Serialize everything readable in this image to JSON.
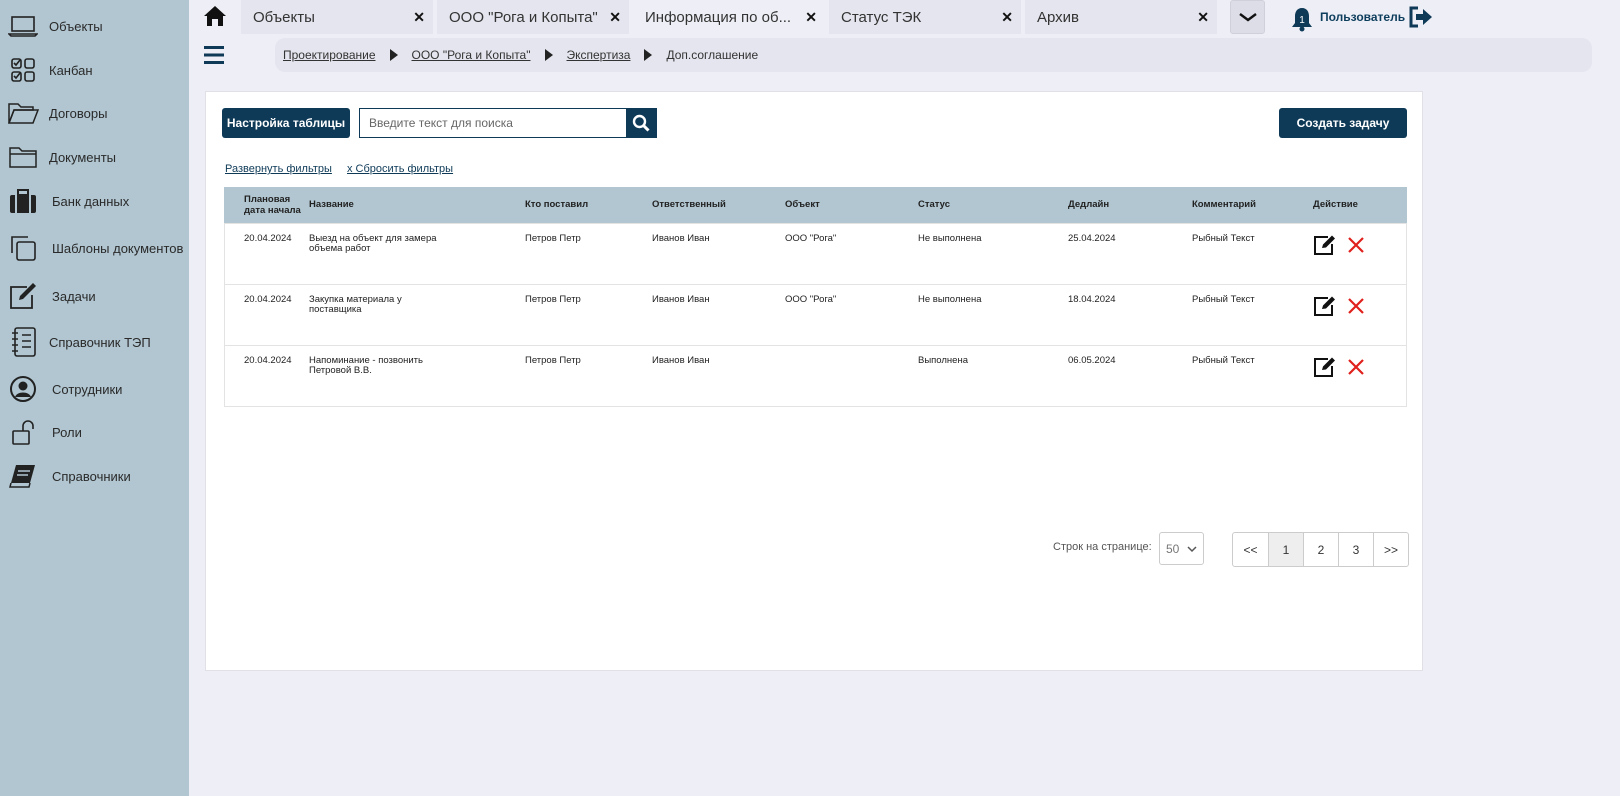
{
  "sidebar": {
    "items": [
      {
        "label": "Объекты",
        "icon": "laptop-icon"
      },
      {
        "label": "Канбан",
        "icon": "kanban-icon"
      },
      {
        "label": "Договоры",
        "icon": "folder-open-icon"
      },
      {
        "label": "Документы",
        "icon": "folder-icon"
      },
      {
        "label": "Банк данных",
        "icon": "briefcase-icon"
      },
      {
        "label": "Шаблоны документов",
        "icon": "copy-icon"
      },
      {
        "label": "Задачи",
        "icon": "edit-icon"
      },
      {
        "label": "Справочник ТЭП",
        "icon": "list-book-icon"
      },
      {
        "label": "Сотрудники",
        "icon": "user-circle-icon"
      },
      {
        "label": "Роли",
        "icon": "unlock-icon"
      },
      {
        "label": "Справочники",
        "icon": "book-icon"
      }
    ]
  },
  "tabs": [
    {
      "label": "Объекты",
      "close": "✕"
    },
    {
      "label": "ООО \"Рога и Копыта\"",
      "close": "✕"
    },
    {
      "label": "Информация по об...",
      "close": "✕"
    },
    {
      "label": "Статус ТЭК",
      "close": "✕"
    },
    {
      "label": "Архив",
      "close": "✕"
    }
  ],
  "header": {
    "user_label": "Пользователь",
    "notifications_count": "1"
  },
  "breadcrumb": [
    "Проектирование",
    "ООО \"Рога и Копыта\"",
    "Экспертиза",
    "Доп.соглашение"
  ],
  "toolbar": {
    "settings_label": "Настройка таблицы",
    "search_placeholder": "Введите текст для поиска",
    "create_label": "Создать задачу",
    "expand_filters": "Развернуть фильтры",
    "reset_filters": "x Сбросить фильтры"
  },
  "table": {
    "headers": [
      "Плановая дата начала",
      "Название",
      "Кто поставил",
      "Ответственный",
      "Объект",
      "Статус",
      "Дедлайн",
      "Комментарий",
      "Действие"
    ],
    "rows": [
      [
        "20.04.2024",
        "Выезд на объект для замера объема работ",
        "Петров Петр",
        "Иванов Иван",
        "ООО \"Рога\"",
        "Не выполнена",
        "25.04.2024",
        "Рыбный Текст"
      ],
      [
        "20.04.2024",
        "Закупка материала у поставщика",
        "Петров Петр",
        "Иванов Иван",
        "ООО \"Рога\"",
        "Не выполнена",
        "18.04.2024",
        "Рыбный Текст"
      ],
      [
        "20.04.2024",
        "Напоминание - позвонить Петровой В.В.",
        "Петров Петр",
        "Иванов Иван",
        "",
        "Выполнена",
        "06.05.2024",
        "Рыбный Текст"
      ]
    ]
  },
  "pagination": {
    "rows_label": "Строк на странице:",
    "rows_value": "50",
    "first": "<<",
    "pages": [
      "1",
      "2",
      "3"
    ],
    "last": ">>",
    "current": "1"
  },
  "colors": {
    "sidebar_bg": "#b1c6d1",
    "primary": "#0e3a57",
    "delete": "#e0201c"
  }
}
